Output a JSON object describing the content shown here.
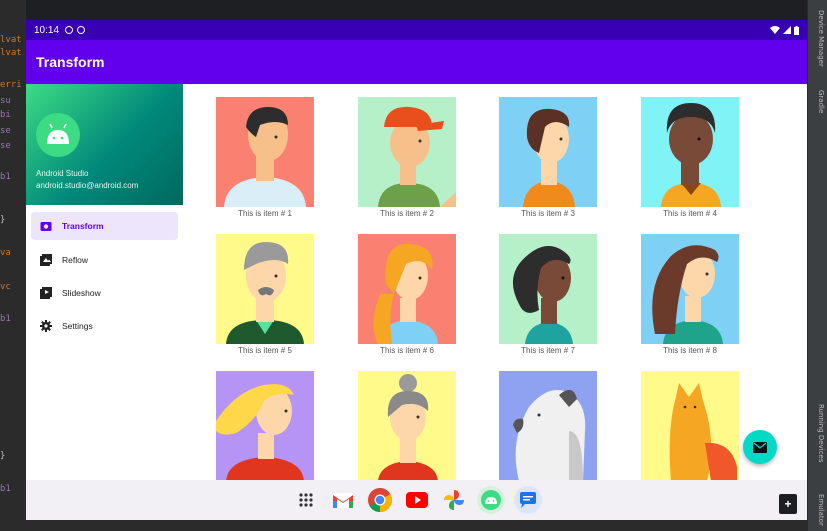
{
  "ide": {
    "code_fragments": [
      "lvat",
      "lvat",
      "erri",
      "su",
      "bi",
      "se",
      "se",
      "b1",
      "}",
      "va",
      "vc",
      "b1",
      "}",
      "b1"
    ],
    "right_labels": [
      "Device Manager",
      "Gradle",
      "Running Devices",
      "Emulator"
    ]
  },
  "status": {
    "time": "10:14"
  },
  "app": {
    "title": "Transform"
  },
  "drawer": {
    "name": "Android Studio",
    "email": "android.studio@android.com",
    "items": [
      {
        "label": "Transform",
        "icon": "camera-icon",
        "active": true
      },
      {
        "label": "Reflow",
        "icon": "image-icon",
        "active": false
      },
      {
        "label": "Slideshow",
        "icon": "slideshow-icon",
        "active": false
      },
      {
        "label": "Settings",
        "icon": "gear-icon",
        "active": false
      }
    ]
  },
  "grid": {
    "items": [
      {
        "caption": "This is item # 1",
        "bg": "#fa8072"
      },
      {
        "caption": "This is item # 2",
        "bg": "#b6f0c8"
      },
      {
        "caption": "This is item # 3",
        "bg": "#7fd0f5"
      },
      {
        "caption": "This is item # 4",
        "bg": "#7ff3f5"
      },
      {
        "caption": "This is item # 5",
        "bg": "#fffa8a"
      },
      {
        "caption": "This is item # 6",
        "bg": "#fa8072"
      },
      {
        "caption": "This is item # 7",
        "bg": "#b6f0c8"
      },
      {
        "caption": "This is item # 8",
        "bg": "#7fd0f5"
      },
      {
        "caption": "",
        "bg": "#b594f5"
      },
      {
        "caption": "",
        "bg": "#fffa8a"
      },
      {
        "caption": "",
        "bg": "#8fa2f2"
      },
      {
        "caption": "",
        "bg": "#fffa8a"
      }
    ]
  },
  "taskbar": {
    "apps": [
      "app-drawer-icon",
      "gmail-icon",
      "chrome-icon",
      "youtube-icon",
      "photos-icon",
      "android-icon",
      "messages-icon"
    ]
  },
  "colors": {
    "primary": "#6200ee",
    "primary_dark": "#3700b3",
    "accent": "#03dac5"
  },
  "ext": {
    "plus": "+"
  }
}
